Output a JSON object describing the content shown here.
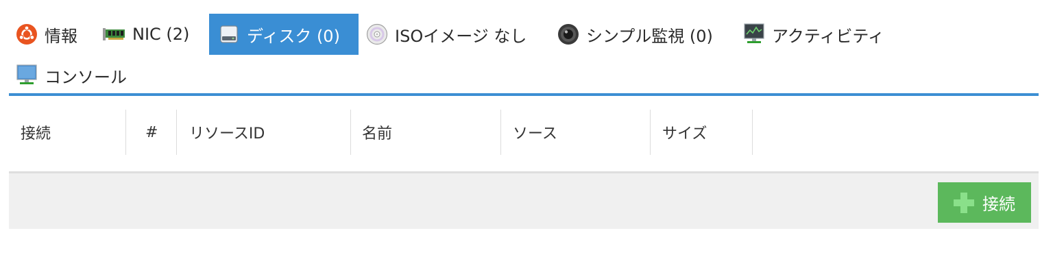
{
  "tabs": [
    {
      "id": "info",
      "label": "情報",
      "icon": "ubuntu-icon",
      "active": false
    },
    {
      "id": "nic",
      "label": "NIC (2)",
      "icon": "network-card-icon",
      "active": false
    },
    {
      "id": "disk",
      "label": "ディスク (0)",
      "icon": "hard-disk-icon",
      "active": true
    },
    {
      "id": "iso",
      "label": "ISOイメージ なし",
      "icon": "cd-disc-icon",
      "active": false
    },
    {
      "id": "monitor",
      "label": "シンプル監視 (0)",
      "icon": "camera-icon",
      "active": false
    },
    {
      "id": "activity",
      "label": "アクティビティ",
      "icon": "activity-monitor-icon",
      "active": false
    },
    {
      "id": "console",
      "label": "コンソール",
      "icon": "console-monitor-icon",
      "active": false
    }
  ],
  "table": {
    "columns": [
      "接続",
      "#",
      "リソースID",
      "名前",
      "ソース",
      "サイズ"
    ]
  },
  "footer": {
    "connect_label": "接続"
  },
  "colors": {
    "accent": "#3a8ed4",
    "success": "#5cb85c"
  }
}
